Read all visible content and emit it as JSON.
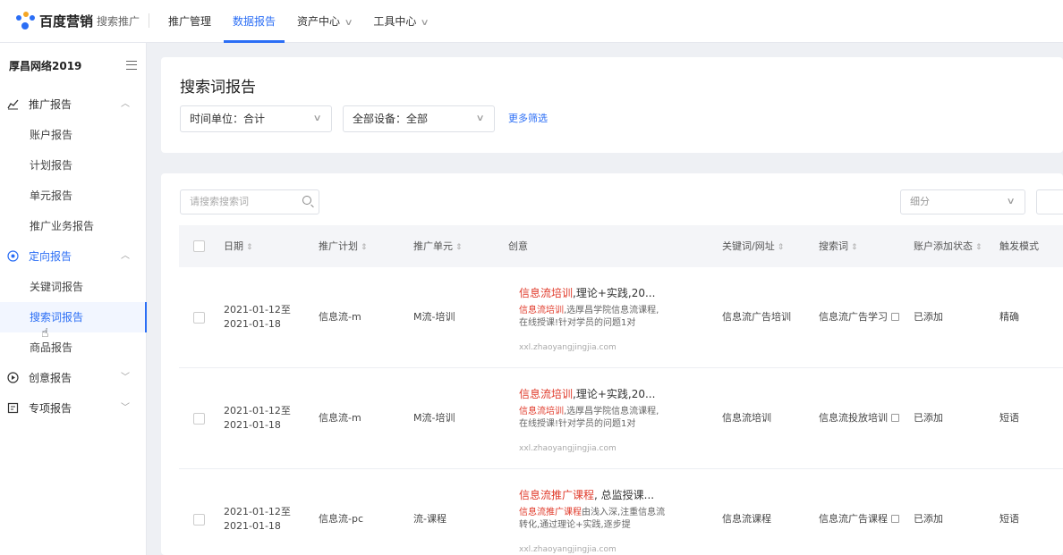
{
  "brand": {
    "name": "百度营销",
    "sub": "搜索推广"
  },
  "nav": [
    {
      "label": "推广管理",
      "active": false,
      "dropdown": false
    },
    {
      "label": "数据报告",
      "active": true,
      "dropdown": false
    },
    {
      "label": "资产中心",
      "active": false,
      "dropdown": true
    },
    {
      "label": "工具中心",
      "active": false,
      "dropdown": true
    }
  ],
  "sidebar": {
    "account": "厚昌网络2019",
    "groups": [
      {
        "label": "推广报告",
        "icon": "chart-line-icon",
        "expanded": true,
        "items": [
          "账户报告",
          "计划报告",
          "单元报告",
          "推广业务报告"
        ]
      },
      {
        "label": "定向报告",
        "icon": "target-icon",
        "expanded": true,
        "items": [
          "关键词报告",
          "搜索词报告",
          "商品报告"
        ]
      },
      {
        "label": "创意报告",
        "icon": "play-circle-icon",
        "expanded": false,
        "items": []
      },
      {
        "label": "专项报告",
        "icon": "report-icon",
        "expanded": false,
        "items": []
      }
    ],
    "active_item": "搜索词报告"
  },
  "page": {
    "title": "搜索词报告",
    "filters": {
      "time_unit": "时间单位：合计",
      "device": "全部设备：全部",
      "more": "更多筛选"
    }
  },
  "table": {
    "search_placeholder": "请搜索搜索词",
    "segment_placeholder": "细分",
    "columns": [
      "日期",
      "推广计划",
      "推广单元",
      "创意",
      "关键词/网址",
      "搜索词",
      "账户添加状态",
      "触发模式"
    ],
    "rows": [
      {
        "date": "2021-01-12至2021-01-18",
        "plan": "信息流-m",
        "unit": "M流-培训",
        "creative_title_hl": "信息流培训",
        "creative_title_rest": ",理论+实践,20...",
        "creative_desc_hl": "信息流培训",
        "creative_desc_rest": ",选厚昌学院信息流课程,在线授课!针对学员的问题1对",
        "creative_url": "xxl.zhaoyangjingjia.com",
        "keyword": "信息流广告培训",
        "search_term": "信息流广告学习",
        "status": "已添加",
        "trigger": "精确"
      },
      {
        "date": "2021-01-12至2021-01-18",
        "plan": "信息流-m",
        "unit": "M流-培训",
        "creative_title_hl": "信息流培训",
        "creative_title_rest": ",理论+实践,20...",
        "creative_desc_hl": "信息流培训",
        "creative_desc_rest": ",选厚昌学院信息流课程,在线授课!针对学员的问题1对",
        "creative_url": "xxl.zhaoyangjingjia.com",
        "keyword": "信息流培训",
        "search_term": "信息流投放培训",
        "status": "已添加",
        "trigger": "短语"
      },
      {
        "date": "2021-01-12至2021-01-18",
        "plan": "信息流-pc",
        "unit": "流-课程",
        "creative_title_hl": "信息流推广课程",
        "creative_title_rest": ", 总监授课...",
        "creative_desc_hl": "信息流推广课程",
        "creative_desc_rest": "由浅入深,注重信息流转化,通过理论+实践,逐步提",
        "creative_url": "xxl.zhaoyangjingjia.com",
        "keyword": "信息流课程",
        "search_term": "信息流广告课程",
        "status": "已添加",
        "trigger": "短语"
      }
    ]
  }
}
